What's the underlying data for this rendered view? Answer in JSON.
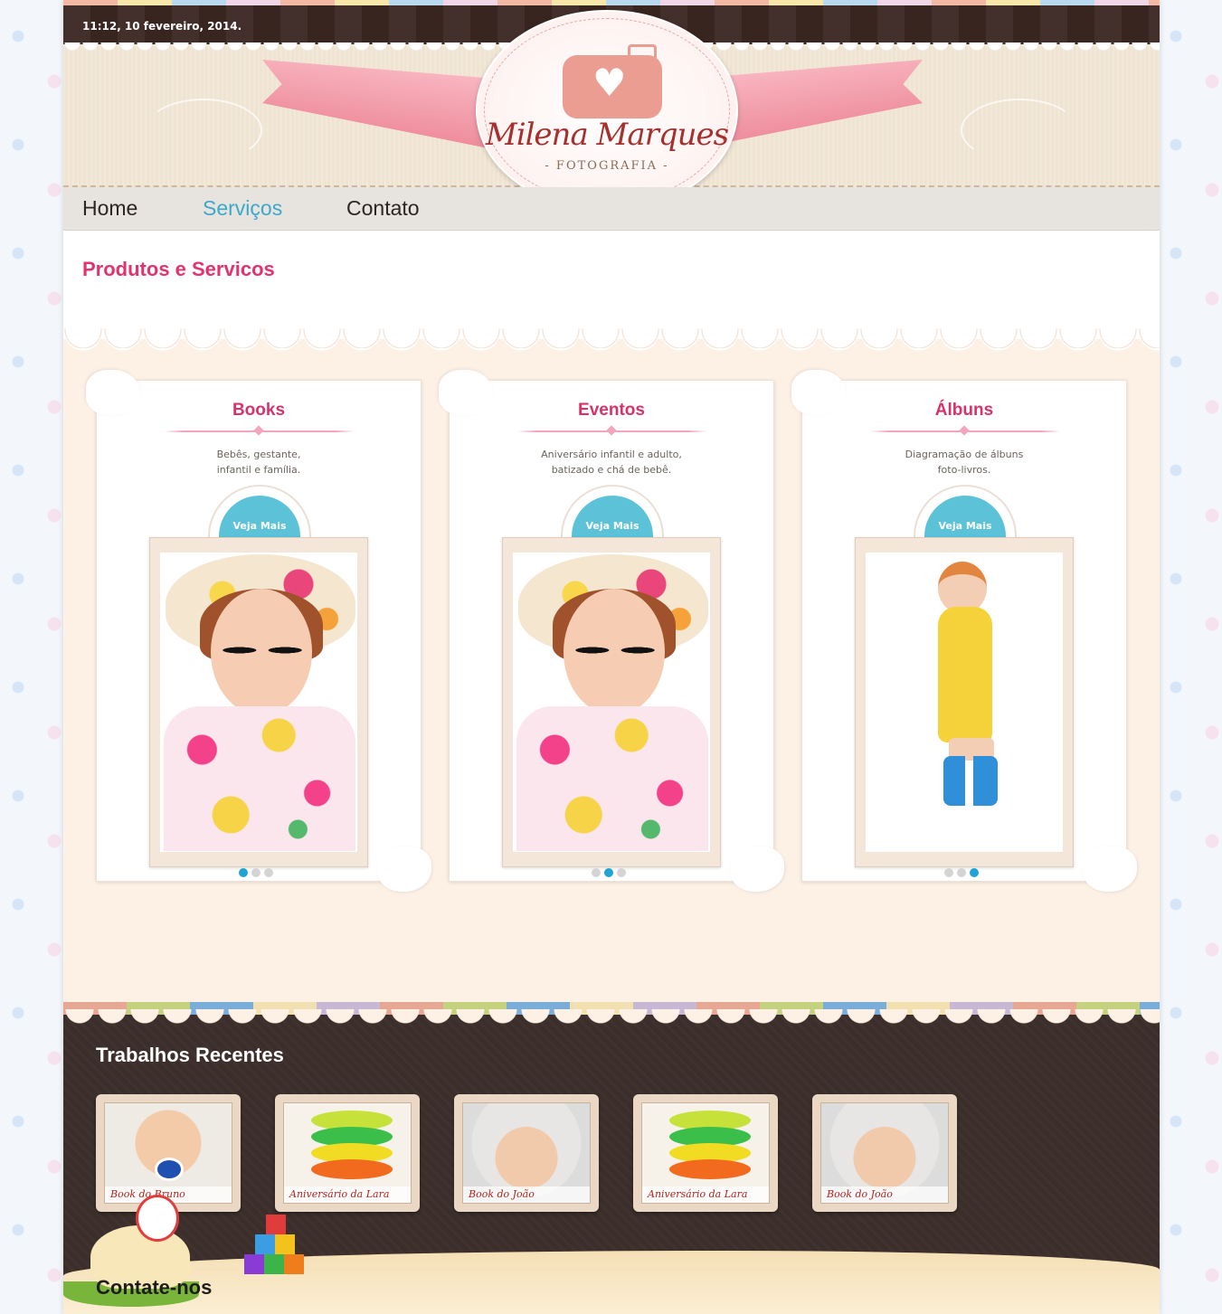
{
  "header": {
    "datetime": "11:12, 10 fevereiro, 2014.",
    "logo_name": "Milena Marques",
    "logo_sub": "- FOTOGRAFIA -"
  },
  "nav": {
    "items": [
      {
        "label": "Home",
        "active": false
      },
      {
        "label": "Serviços",
        "active": true
      },
      {
        "label": "Contato",
        "active": false
      }
    ]
  },
  "main": {
    "title": "Produtos e Servicos",
    "cards": [
      {
        "title": "Books",
        "desc_line1": "Bebês, gestante,",
        "desc_line2": "infantil e família.",
        "button": "Veja Mais",
        "active_dot": 0
      },
      {
        "title": "Eventos",
        "desc_line1": "Aniversário infantil e adulto,",
        "desc_line2": "batizado e chá de bebê.",
        "button": "Veja Mais",
        "active_dot": 1
      },
      {
        "title": "Álbuns",
        "desc_line1": "Diagramação de álbuns",
        "desc_line2": "foto-livros.",
        "button": "Veja Mais",
        "active_dot": 2
      }
    ]
  },
  "recent": {
    "title": "Trabalhos Recentes",
    "items": [
      {
        "caption": "Book do Bruno"
      },
      {
        "caption": "Aniversário da Lara"
      },
      {
        "caption": "Book do João"
      },
      {
        "caption": "Aniversário da Lara"
      },
      {
        "caption": "Book do João"
      }
    ]
  },
  "footer": {
    "contact_label": "Contate-nos"
  },
  "colors": {
    "accent_pink": "#e2336f",
    "accent_blue": "#3aa9cb",
    "button_blue": "#5bc2d8",
    "dark_brown": "#3c2f2b"
  }
}
